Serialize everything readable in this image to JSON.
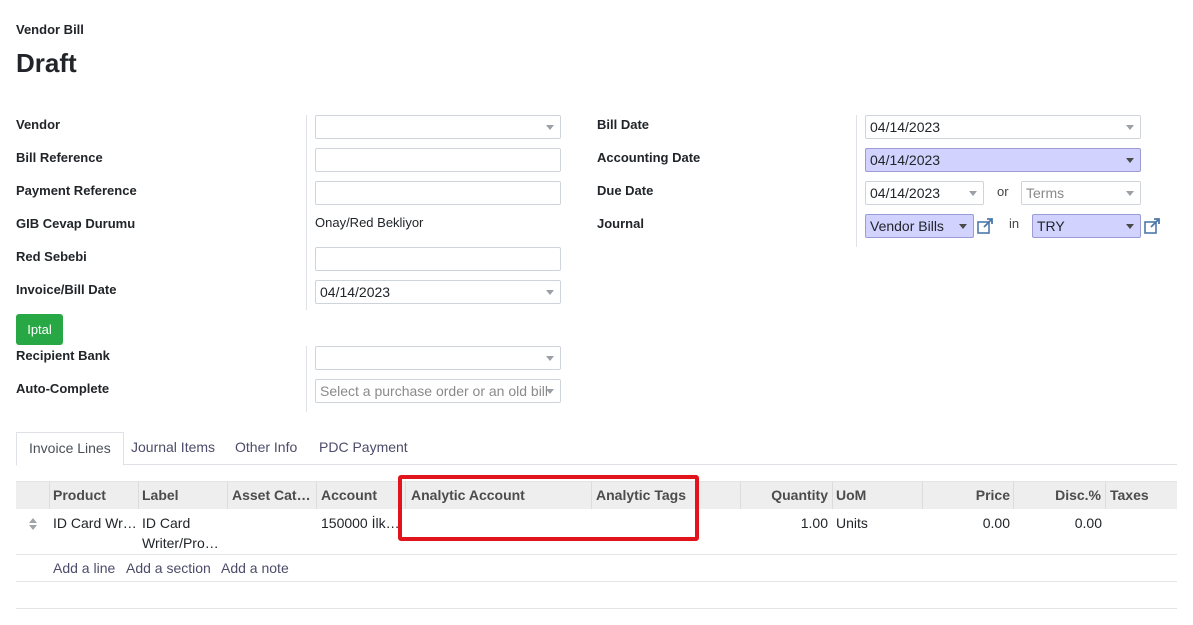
{
  "header": {
    "doc_type": "Vendor Bill",
    "status": "Draft"
  },
  "left_form": {
    "vendor": {
      "label": "Vendor",
      "value": ""
    },
    "bill_reference": {
      "label": "Bill Reference",
      "value": ""
    },
    "payment_reference": {
      "label": "Payment Reference",
      "value": ""
    },
    "gib_cevap_durumu": {
      "label": "GIB Cevap Durumu",
      "value": "Onay/Red Bekliyor"
    },
    "red_sebebi": {
      "label": "Red Sebebi",
      "value": ""
    },
    "invoice_bill_date": {
      "label": "Invoice/Bill Date",
      "value": "04/14/2023"
    },
    "iptal_button": "Iptal",
    "recipient_bank": {
      "label": "Recipient Bank",
      "value": ""
    },
    "auto_complete": {
      "label": "Auto-Complete",
      "placeholder": "Select a purchase order or an old bill"
    }
  },
  "right_form": {
    "bill_date": {
      "label": "Bill Date",
      "value": "04/14/2023"
    },
    "accounting_date": {
      "label": "Accounting Date",
      "value": "04/14/2023"
    },
    "due_date": {
      "label": "Due Date",
      "value": "04/14/2023",
      "or_text": "or",
      "terms_placeholder": "Terms"
    },
    "journal": {
      "label": "Journal",
      "value": "Vendor Bills",
      "in_text": "in",
      "currency": "TRY"
    }
  },
  "tabs": [
    {
      "label": "Invoice Lines",
      "active": true
    },
    {
      "label": "Journal Items",
      "active": false
    },
    {
      "label": "Other Info",
      "active": false
    },
    {
      "label": "PDC Payment",
      "active": false
    }
  ],
  "table": {
    "columns": [
      "Product",
      "Label",
      "Asset Cate…",
      "Account",
      "Analytic Account",
      "Analytic Tags",
      "Quantity",
      "UoM",
      "Price",
      "Disc.%",
      "Taxes"
    ],
    "rows": [
      {
        "product": "ID Card Wri…",
        "label_line1": "ID Card",
        "label_line2": "Writer/Prog…",
        "asset_category": "",
        "account": "150000 İlk …",
        "analytic_account": "",
        "analytic_tags": "",
        "quantity": "1.00",
        "uom": "Units",
        "price": "0.00",
        "discount": "0.00",
        "taxes": ""
      }
    ],
    "actions": [
      "Add a line",
      "Add a section",
      "Add a note"
    ]
  },
  "colors": {
    "required_field_bg": "#d2d2ff",
    "iptal_button_bg": "#28a745",
    "highlight_border": "#e0141a",
    "link_color": "#4c4c6a"
  }
}
